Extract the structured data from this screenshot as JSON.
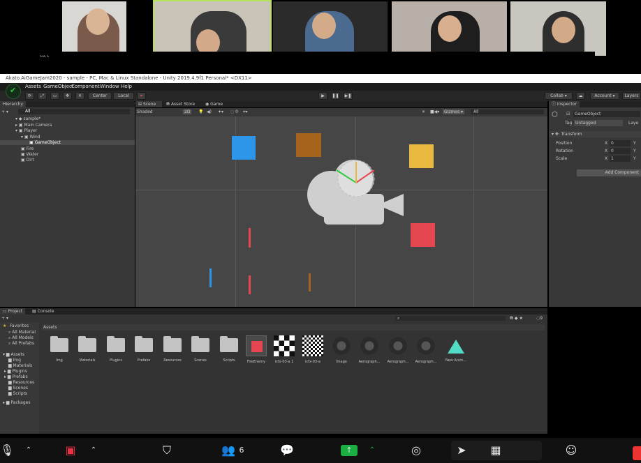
{
  "video": {
    "tiles": [
      {
        "name": "ᒡᒡᒡ ᒡ"
      },
      {
        "name": ""
      },
      {
        "name": ""
      },
      {
        "name": ""
      },
      {
        "name": ""
      }
    ]
  },
  "window": {
    "title": "Akato.AiGameJam2020 - sample - PC, Mac & Linux Standalone - Unity 2019.4.9f1 Personal* <DX11>"
  },
  "menu": [
    "Assets",
    "GameObject",
    "Component",
    "Window",
    "Help"
  ],
  "toolbar": {
    "pivot_label": "Center",
    "space_label": "Local",
    "collab_label": "Collab ▾",
    "account_label": "Account ▾",
    "layers_label": "Layers"
  },
  "hierarchy": {
    "tab": "Hierarchy",
    "search_placeholder": "All",
    "items": [
      {
        "label": "sample*"
      },
      {
        "label": "Main Camera"
      },
      {
        "label": "Player"
      },
      {
        "label": "Wind"
      },
      {
        "label": "GameObject"
      },
      {
        "label": "Fire"
      },
      {
        "label": "Water"
      },
      {
        "label": "Dirt"
      }
    ]
  },
  "scene_tabs": [
    "Scene",
    "Asset Store",
    "Game"
  ],
  "scene_toolbar": {
    "shading": "Shaded",
    "mode_2d": "2D",
    "gizmos": "Gizmos ▾",
    "search_placeholder": "All"
  },
  "inspector": {
    "tab": "Inspector",
    "object_name": "GameObject",
    "tag_label": "Tag",
    "tag_value": "Untagged",
    "layer_label": "Laye",
    "transform_label": "Transform",
    "rows": [
      {
        "label": "Position",
        "axis": "X",
        "value": "0",
        "y_axis": "Y"
      },
      {
        "label": "Rotation",
        "axis": "X",
        "value": "0",
        "y_axis": "Y"
      },
      {
        "label": "Scale",
        "axis": "X",
        "value": "1",
        "y_axis": "Y"
      }
    ],
    "add_component": "Add Component"
  },
  "project": {
    "tabs": [
      "Project",
      "Console"
    ],
    "count": "9",
    "favorites_label": "Favorites",
    "favorites": [
      "All Material",
      "All Models",
      "All Prefabs"
    ],
    "assets_label": "Assets",
    "folders": [
      "Img",
      "Materials",
      "Plugins",
      "Prefabs",
      "Resources",
      "Scenes",
      "Scripts"
    ],
    "packages_label": "Packages",
    "breadcrumb": "Assets",
    "items": [
      {
        "label": "Img",
        "kind": "folder"
      },
      {
        "label": "Materials",
        "kind": "folder"
      },
      {
        "label": "Plugins",
        "kind": "folder"
      },
      {
        "label": "Prefabs",
        "kind": "folder"
      },
      {
        "label": "Resources",
        "kind": "folder"
      },
      {
        "label": "Scenes",
        "kind": "folder"
      },
      {
        "label": "Scripts",
        "kind": "folder"
      },
      {
        "label": "FireEnemy",
        "kind": "prefab"
      },
      {
        "label": "icfx-03-a 1",
        "kind": "checker"
      },
      {
        "label": "icfx-03-a",
        "kind": "checker"
      },
      {
        "label": "Image",
        "kind": "circle"
      },
      {
        "label": "Aerograph...",
        "kind": "circle"
      },
      {
        "label": "Aerograph...",
        "kind": "circle"
      },
      {
        "label": "Aerograph...",
        "kind": "circle"
      },
      {
        "label": "New Anim...",
        "kind": "triangle"
      }
    ]
  },
  "zoom": {
    "participants_count": "6"
  },
  "colors": {
    "blue": "#2e96e8",
    "brown": "#a3631b",
    "yellow": "#e8b93e",
    "red": "#e54650",
    "teal": "#52dcc7",
    "zoom_green": "#1aae43"
  }
}
